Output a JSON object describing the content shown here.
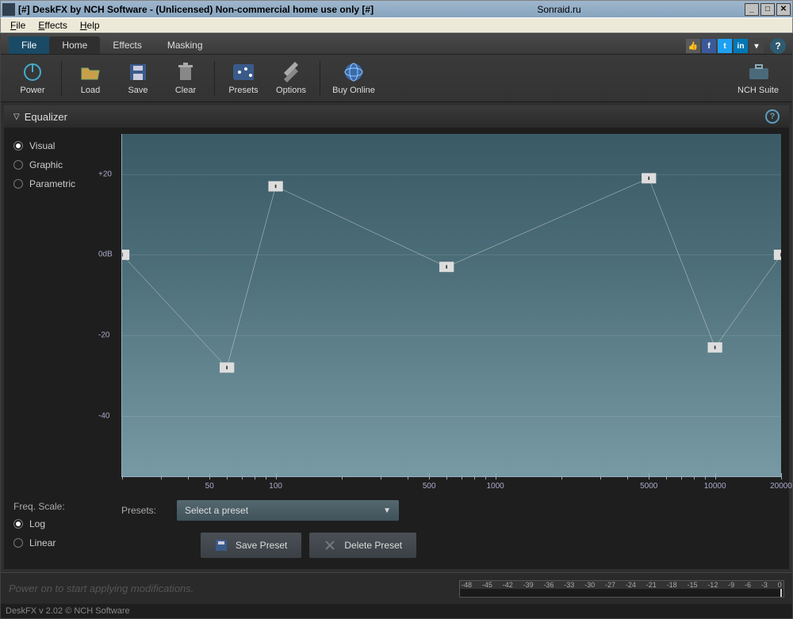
{
  "titlebar": {
    "title": "[#] DeskFX by NCH Software - (Unlicensed) Non-commercial home use only [#]",
    "center": "Sonraid.ru"
  },
  "winmenu": {
    "file": "File",
    "effects": "Effects",
    "help": "Help"
  },
  "ribbon": {
    "tabs": {
      "file": "File",
      "home": "Home",
      "effects": "Effects",
      "masking": "Masking"
    }
  },
  "toolbar": {
    "power": "Power",
    "load": "Load",
    "save": "Save",
    "clear": "Clear",
    "presets": "Presets",
    "options": "Options",
    "buy": "Buy Online",
    "suite": "NCH Suite"
  },
  "panel": {
    "title": "Equalizer",
    "modes": {
      "visual": "Visual",
      "graphic": "Graphic",
      "parametric": "Parametric"
    },
    "freq_label": "Freq. Scale:",
    "scale": {
      "log": "Log",
      "linear": "Linear"
    }
  },
  "presets": {
    "label": "Presets:",
    "placeholder": "Select a preset",
    "save": "Save Preset",
    "delete": "Delete Preset"
  },
  "status": {
    "hint": "Power on to start applying modifications.",
    "version": "DeskFX v 2.02 © NCH Software"
  },
  "meter_ticks": [
    "-48",
    "-45",
    "-42",
    "-39",
    "-36",
    "-33",
    "-30",
    "-27",
    "-24",
    "-21",
    "-18",
    "-15",
    "-12",
    "-9",
    "-6",
    "-3",
    "0"
  ],
  "chart_data": {
    "type": "line",
    "xlabel": "",
    "ylabel": "",
    "ylim": [
      -55,
      30
    ],
    "yticks": [
      {
        "v": 20,
        "label": "+20"
      },
      {
        "v": 0,
        "label": "0dB"
      },
      {
        "v": -20,
        "label": "-20"
      },
      {
        "v": -40,
        "label": "-40"
      }
    ],
    "x_ticks_log": [
      50,
      100,
      500,
      1000,
      5000,
      10000,
      20000
    ],
    "x_minor_ticks_log": [
      20,
      30,
      40,
      60,
      70,
      80,
      90,
      200,
      300,
      400,
      600,
      700,
      800,
      900,
      2000,
      3000,
      4000,
      6000,
      7000,
      8000,
      9000
    ],
    "nodes": [
      {
        "freq": 20,
        "gain": 0
      },
      {
        "freq": 60,
        "gain": -28
      },
      {
        "freq": 100,
        "gain": 17
      },
      {
        "freq": 600,
        "gain": -3
      },
      {
        "freq": 5000,
        "gain": 19
      },
      {
        "freq": 10000,
        "gain": -23
      },
      {
        "freq": 20000,
        "gain": 0
      }
    ]
  }
}
